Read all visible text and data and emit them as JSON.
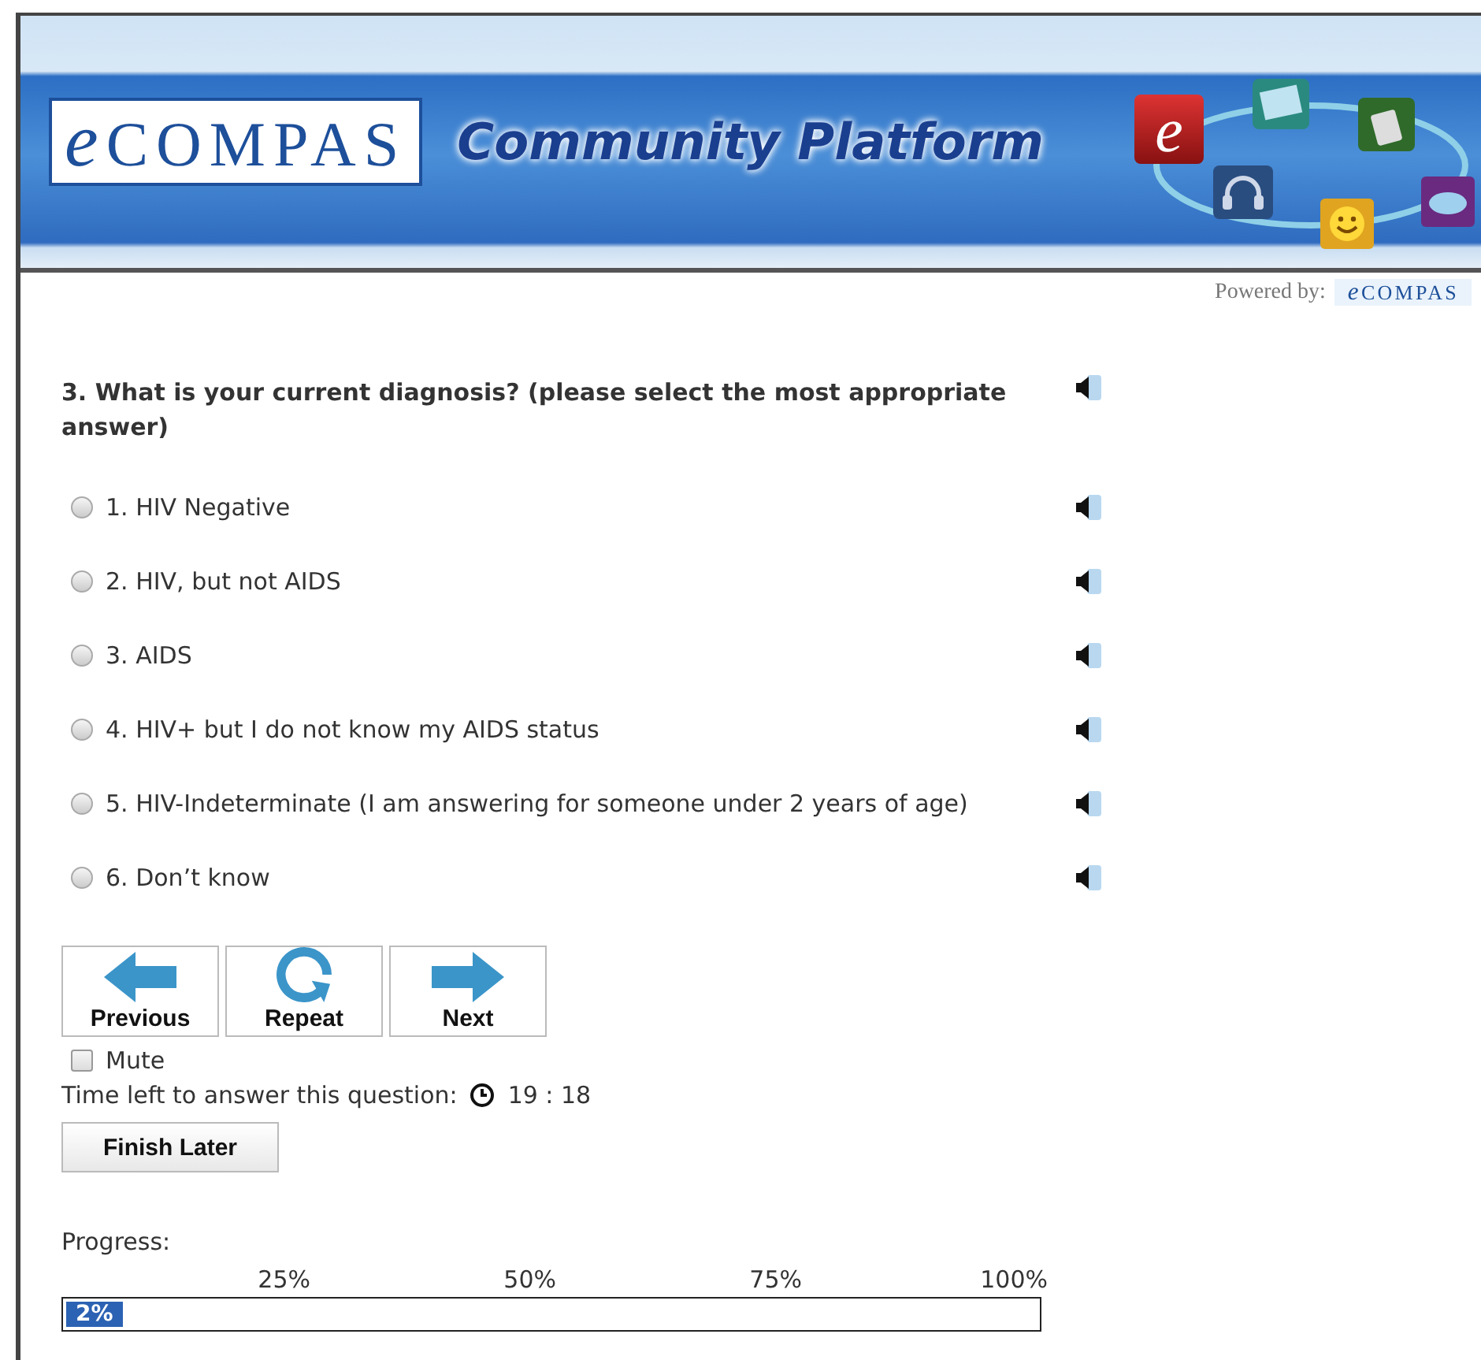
{
  "header": {
    "logo": {
      "mark": "e",
      "name": "COMPAS"
    },
    "title": "Community Platform",
    "app_tile_letter": "e",
    "powered_by": {
      "label": "Powered by:",
      "logo": {
        "mark": "e",
        "name": "COMPAS"
      }
    }
  },
  "question": {
    "text": "3. What is your current diagnosis? (please select the most appropriate answer)",
    "options": [
      {
        "label": "1. HIV Negative",
        "selected": false
      },
      {
        "label": "2. HIV, but not AIDS",
        "selected": false
      },
      {
        "label": "3. AIDS",
        "selected": false
      },
      {
        "label": "4. HIV+ but I do not know my AIDS status",
        "selected": false
      },
      {
        "label": "5. HIV-Indeterminate (I am answering for someone under 2 years of age)",
        "selected": false
      },
      {
        "label": "6. Don’t know",
        "selected": false
      }
    ]
  },
  "nav_buttons": [
    {
      "kind": "previous",
      "label": "Previous"
    },
    {
      "kind": "repeat",
      "label": "Repeat"
    },
    {
      "kind": "next",
      "label": "Next"
    }
  ],
  "mute": {
    "label": "Mute",
    "checked": false
  },
  "timer": {
    "label": "Time left to answer this question:",
    "value": "19 : 18"
  },
  "finish_button": "Finish Later",
  "progress": {
    "label": "Progress:",
    "ticks": [
      "25%",
      "50%",
      "75%",
      "100%"
    ],
    "level": 0.02,
    "reading": "2%"
  }
}
